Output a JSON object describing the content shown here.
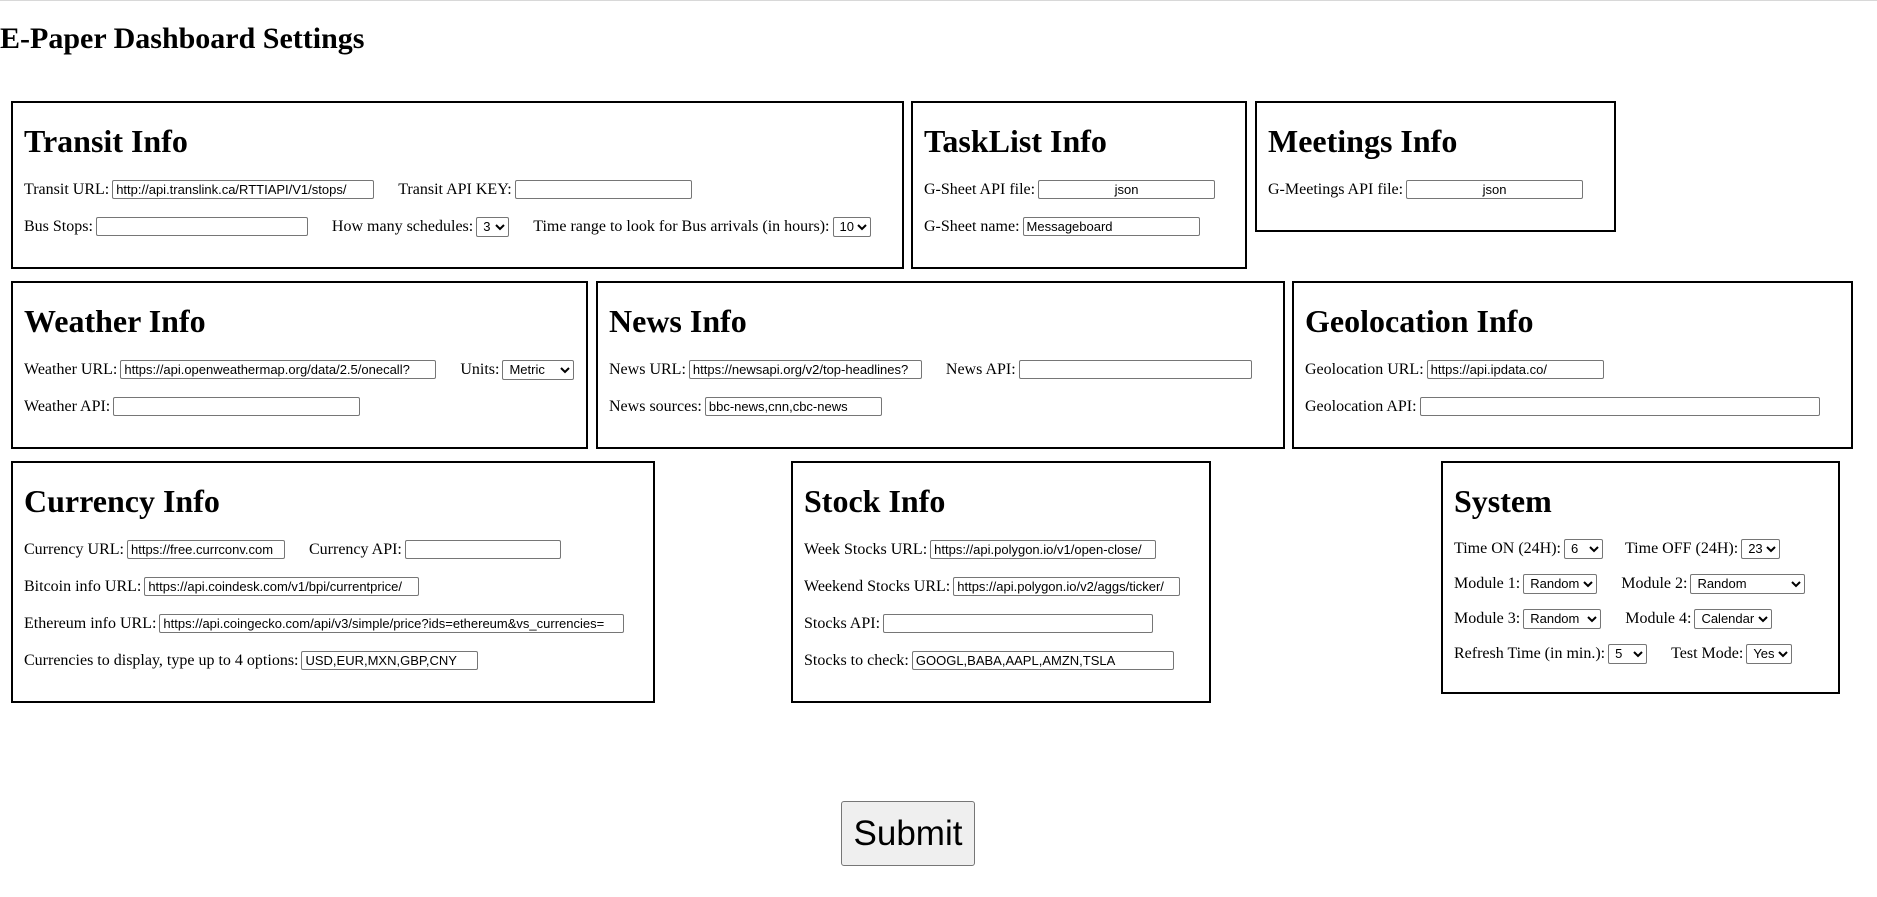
{
  "page": {
    "title": "E-Paper Dashboard Settings"
  },
  "transit": {
    "heading": "Transit Info",
    "url_label": "Transit URL:",
    "url_value": "http://api.translink.ca/RTTIAPI/V1/stops/",
    "key_label": "Transit API KEY:",
    "key_value": "",
    "stops_label": "Bus Stops:",
    "stops_value": "",
    "schedules_label": "How many schedules:",
    "schedules_value": "3",
    "range_label": "Time range to look for Bus arrivals (in hours):",
    "range_value": "10"
  },
  "tasklist": {
    "heading": "TaskList Info",
    "api_label": "G-Sheet API file:",
    "api_value": "json",
    "name_label": "G-Sheet name:",
    "name_value": "Messageboard"
  },
  "meetings": {
    "heading": "Meetings Info",
    "api_label": "G-Meetings API file:",
    "api_value": "json"
  },
  "weather": {
    "heading": "Weather Info",
    "url_label": "Weather URL:",
    "url_value": "https://api.openweathermap.org/data/2.5/onecall?",
    "units_label": "Units:",
    "units_value": "Metric",
    "api_label": "Weather API:",
    "api_value": ""
  },
  "news": {
    "heading": "News Info",
    "url_label": "News URL:",
    "url_value": "https://newsapi.org/v2/top-headlines?",
    "api_label": "News API:",
    "api_value": "",
    "sources_label": "News sources:",
    "sources_value": "bbc-news,cnn,cbc-news"
  },
  "geo": {
    "heading": "Geolocation Info",
    "url_label": "Geolocation URL:",
    "url_value": "https://api.ipdata.co/",
    "api_label": "Geolocation API:",
    "api_value": ""
  },
  "currency": {
    "heading": "Currency Info",
    "url_label": "Currency URL:",
    "url_value": "https://free.currconv.com",
    "api_label": "Currency API:",
    "api_value": "",
    "btc_label": "Bitcoin info URL:",
    "btc_value": "https://api.coindesk.com/v1/bpi/currentprice/",
    "eth_label": "Ethereum info URL:",
    "eth_value": "https://api.coingecko.com/api/v3/simple/price?ids=ethereum&vs_currencies=",
    "display_label": "Currencies to display, type up to 4 options:",
    "display_value": "USD,EUR,MXN,GBP,CNY"
  },
  "stock": {
    "heading": "Stock Info",
    "week_label": "Week Stocks URL:",
    "week_value": "https://api.polygon.io/v1/open-close/",
    "weekend_label": "Weekend Stocks URL:",
    "weekend_value": "https://api.polygon.io/v2/aggs/ticker/",
    "api_label": "Stocks API:",
    "api_value": "",
    "check_label": "Stocks to check:",
    "check_value": "GOOGL,BABA,AAPL,AMZN,TSLA"
  },
  "system": {
    "heading": "System",
    "on_label": "Time ON (24H):",
    "on_value": "6",
    "off_label": "Time OFF (24H):",
    "off_value": "23",
    "m1_label": "Module 1:",
    "m1_value": "Random",
    "m2_label": "Module 2:",
    "m2_value": "Random",
    "m3_label": "Module 3:",
    "m3_value": "Random",
    "m4_label": "Module 4:",
    "m4_value": "Calendar",
    "refresh_label": "Refresh Time (in min.):",
    "refresh_value": "5",
    "test_label": "Test Mode:",
    "test_value": "Yes"
  },
  "submit_label": "Submit"
}
